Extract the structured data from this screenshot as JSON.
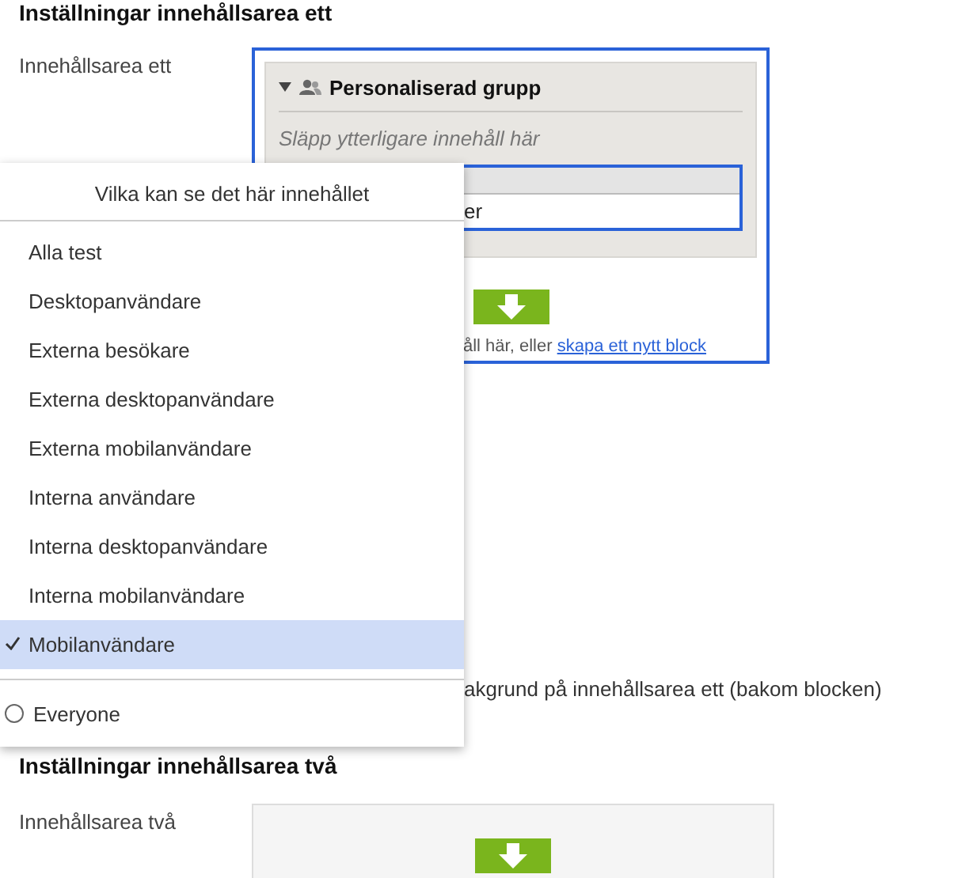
{
  "sections": [
    {
      "heading": "Inställningar innehållsarea ett",
      "label": "Innehållsarea ett",
      "area": {
        "group": {
          "title": "Personaliserad grupp",
          "expanded": true,
          "drop_hint": "Släpp ytterligare innehåll här",
          "block_text": "er"
        },
        "drop_text": "åll här, eller",
        "create_link": "skapa ett nytt block"
      },
      "option_text": "akgrund på innehållsarea ett (bakom blocken)"
    },
    {
      "heading": "Inställningar innehållsarea två",
      "label": "Innehållsarea två"
    }
  ],
  "popup": {
    "title": "Vilka kan se det här innehållet",
    "items": [
      {
        "label": "Alla test",
        "selected": false
      },
      {
        "label": "Desktopanvändare",
        "selected": false
      },
      {
        "label": "Externa besökare",
        "selected": false
      },
      {
        "label": "Externa desktopanvändare",
        "selected": false
      },
      {
        "label": "Externa mobilanvändare",
        "selected": false
      },
      {
        "label": "Interna användare",
        "selected": false
      },
      {
        "label": "Interna desktopanvändare",
        "selected": false
      },
      {
        "label": "Interna mobilanvändare",
        "selected": false
      },
      {
        "label": "Mobilanvändare",
        "selected": true
      }
    ],
    "everyone": {
      "label": "Everyone",
      "checked": false
    }
  }
}
